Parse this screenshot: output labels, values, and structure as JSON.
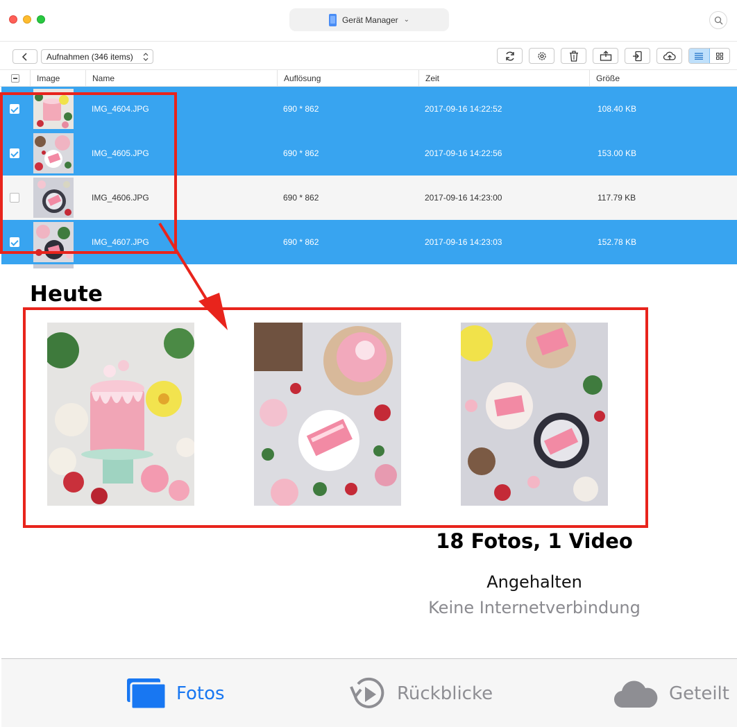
{
  "window": {
    "device_label": "Gerät Manager"
  },
  "toolbar": {
    "album_label": "Aufnahmen (346 items)"
  },
  "table": {
    "columns": [
      "Image",
      "Name",
      "Auflösung",
      "Zeit",
      "Größe"
    ],
    "rows": [
      {
        "selected": true,
        "name": "IMG_4604.JPG",
        "resolution": "690 * 862",
        "time": "2017-09-16 14:22:52",
        "size": "108.40 KB"
      },
      {
        "selected": true,
        "name": "IMG_4605.JPG",
        "resolution": "690 * 862",
        "time": "2017-09-16 14:22:56",
        "size": "153.00 KB"
      },
      {
        "selected": false,
        "name": "IMG_4606.JPG",
        "resolution": "690 * 862",
        "time": "2017-09-16 14:23:00",
        "size": "117.79 KB"
      },
      {
        "selected": true,
        "name": "IMG_4607.JPG",
        "resolution": "690 * 862",
        "time": "2017-09-16 14:23:03",
        "size": "152.78 KB"
      }
    ]
  },
  "photos_app": {
    "section_title": "Heute",
    "summary_count": "18 Fotos, 1 Video",
    "status": "Angehalten",
    "status_detail": "Keine Internetverbindung"
  },
  "tabbar": {
    "tabs": [
      {
        "label": "Fotos",
        "icon": "photos-icon",
        "active": true
      },
      {
        "label": "Rückblicke",
        "icon": "memories-icon",
        "active": false
      },
      {
        "label": "Geteilt",
        "icon": "cloud-icon",
        "active": false
      }
    ]
  },
  "colors": {
    "selection": "#38a4f0",
    "highlight_red": "#e8241c",
    "active_tab": "#1877f2",
    "inactive_tab": "#8e8e93"
  }
}
